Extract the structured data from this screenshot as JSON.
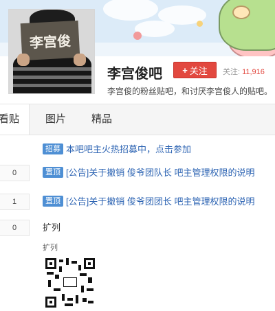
{
  "header": {
    "avatar_text": "李宫俊",
    "title": "李宫俊吧",
    "follow_button": "关注",
    "follow_plus": "+",
    "follow_label": "关注:",
    "follow_count": "11,916",
    "description": "李宫俊的粉丝贴吧，和讨厌李宫俊人的贴吧。"
  },
  "tabs": [
    {
      "label": "看贴",
      "active": true
    },
    {
      "label": "图片",
      "active": false
    },
    {
      "label": "精品",
      "active": false
    }
  ],
  "threads": [
    {
      "reply_count": "",
      "tag": "招募",
      "title": "本吧吧主火热招募中，点击参加"
    },
    {
      "reply_count": "0",
      "tag": "置顶",
      "title": "[公告]关于撤销 俊爷团队长 吧主管理权限的说明"
    },
    {
      "reply_count": "1",
      "tag": "置顶",
      "title": "[公告]关于撤销 俊爷团团长 吧主管理权限的说明"
    },
    {
      "reply_count": "0",
      "tag": "",
      "title": "扩列",
      "snippet": "扩列"
    }
  ],
  "colors": {
    "accent": "#e2483f",
    "link": "#2d64b3",
    "tag": "#4e8fd4",
    "banner": "#dcebf8"
  }
}
